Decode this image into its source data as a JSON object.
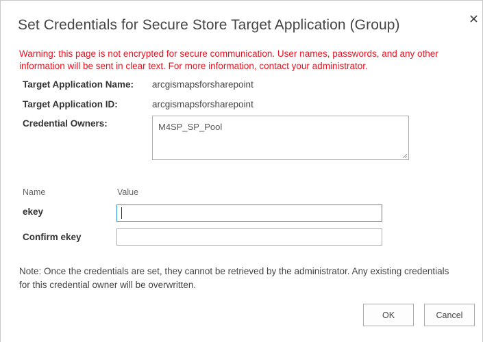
{
  "dialog": {
    "title": "Set Credentials for Secure Store Target Application (Group)",
    "close_icon": "close-icon",
    "warning": "Warning: this page is not encrypted for secure communication. User names, passwords, and any other information will be sent in clear text. For more information, contact your administrator.",
    "warning_color": "#e8111f",
    "target_app_name_label": "Target Application Name:",
    "target_app_name_value": "arcgismapsforsharepoint",
    "target_app_id_label": "Target Application ID:",
    "target_app_id_value": "arcgismapsforsharepoint",
    "credential_owners_label": "Credential Owners:",
    "credential_owners_value": "M4SP_SP_Pool",
    "fields_header": {
      "name": "Name",
      "value": "Value"
    },
    "fields": [
      {
        "label": "ekey",
        "value": ""
      },
      {
        "label": "Confirm ekey",
        "value": ""
      }
    ],
    "note": "Note: Once the credentials are set, they cannot be retrieved by the administrator. Any existing credentials for this credential owner will be overwritten.",
    "ok_label": "OK",
    "cancel_label": "Cancel",
    "focus_color": "#2a8dd4"
  }
}
